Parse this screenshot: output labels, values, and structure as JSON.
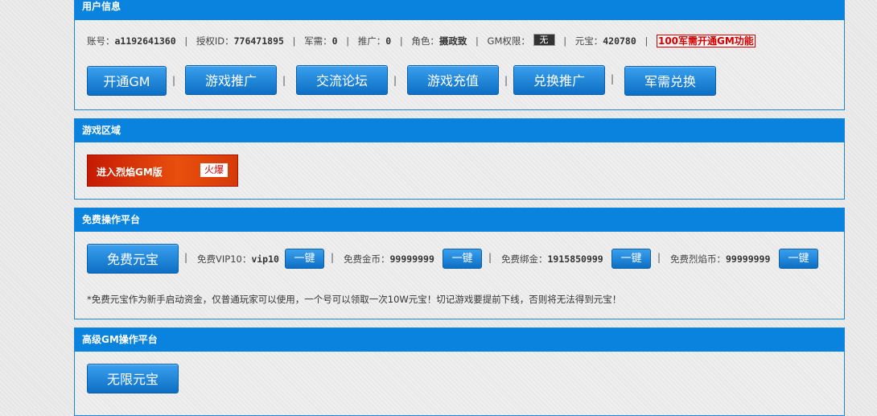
{
  "user_info": {
    "title": "用户信息",
    "account_label": "账号：",
    "account_value": "a1192641360",
    "auth_label": "授权ID：",
    "auth_value": "776471895",
    "military_label": "军需：",
    "military_value": "0",
    "promo_label": "推广：",
    "promo_value": "0",
    "role_label": "角色：",
    "role_value": "摄政致",
    "gm_label": "GM权限：",
    "gm_value": "无",
    "yuanbao_label": "元宝：",
    "yuanbao_value": "420780",
    "gm_link": "100军需开通GM功能",
    "buttons": [
      "开通GM",
      "游戏推广",
      "交流论坛",
      "游戏充值",
      "兑换推广",
      "军需兑换"
    ]
  },
  "game_zone": {
    "title": "游戏区域",
    "banner_text": "进入烈焰GM版",
    "banner_tag": "火爆"
  },
  "free_platform": {
    "title": "免费操作平台",
    "main_button": "免费元宝",
    "items": [
      {
        "label": "免费VIP10：",
        "value": "vip10",
        "button": "一键"
      },
      {
        "label": "免费金币：",
        "value": "99999999",
        "button": "一键"
      },
      {
        "label": "免费绑金：",
        "value": "1915850999",
        "button": "一键"
      },
      {
        "label": "免费烈焰币：",
        "value": "99999999",
        "button": "一键"
      }
    ],
    "note": "*免费元宝作为新手启动资金，仅普通玩家可以使用，一个号可以领取一次10W元宝！切记游戏要提前下线，否则将无法得到元宝！"
  },
  "advanced_platform": {
    "title": "高级GM操作平台",
    "main_button": "无限元宝"
  },
  "colors": {
    "header_blue": "#0a83de",
    "button_blue": "#1a86d8",
    "alert_red": "#d00000",
    "banner_orange": "#e94f0d"
  }
}
